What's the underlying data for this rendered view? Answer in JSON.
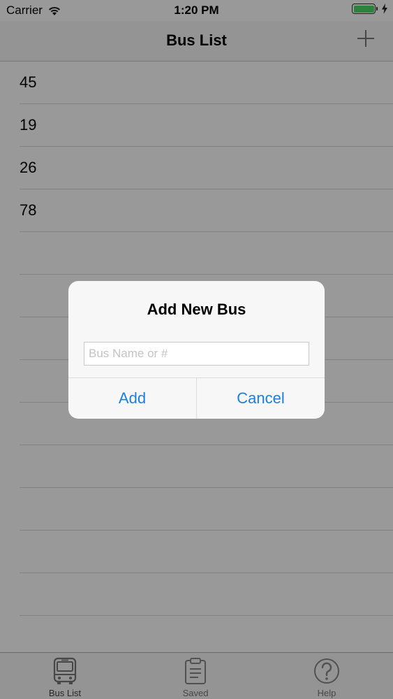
{
  "status_bar": {
    "carrier": "Carrier",
    "time": "1:20 PM",
    "icons": [
      "wifi-icon",
      "battery-icon",
      "charging-bolt-icon"
    ],
    "battery_color": "#4cd964"
  },
  "nav": {
    "title": "Bus List",
    "add_icon": "plus-icon"
  },
  "bus_list": {
    "items": [
      "45",
      "19",
      "26",
      "78"
    ]
  },
  "tab_bar": {
    "tabs": [
      {
        "label": "Bus List",
        "icon": "bus-icon",
        "active": true
      },
      {
        "label": "Saved",
        "icon": "clipboard-icon",
        "active": false
      },
      {
        "label": "Help",
        "icon": "help-circle-icon",
        "active": false
      }
    ]
  },
  "alert": {
    "title": "Add New Bus",
    "input_value": "",
    "input_placeholder": "Bus Name or #",
    "add_label": "Add",
    "cancel_label": "Cancel",
    "button_color": "#1a7fe0"
  }
}
